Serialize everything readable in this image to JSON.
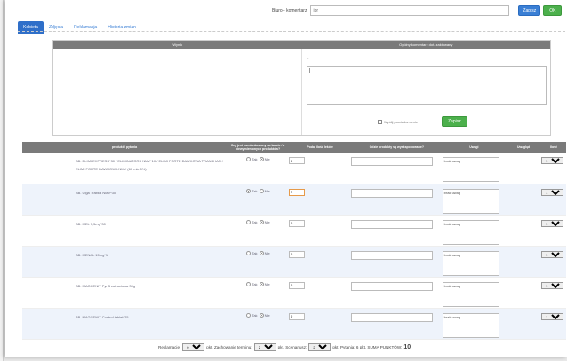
{
  "topbar": {
    "search_label": "Biuro - komentarz",
    "search_value": "ipr",
    "save_label": "Zapisz",
    "ok_label": "OK"
  },
  "tabs": [
    {
      "label": "Kobieta"
    },
    {
      "label": "Zdjęcia"
    },
    {
      "label": "Reklamacja"
    },
    {
      "label": "Historia zmian"
    }
  ],
  "comments": {
    "col_left": "Wynik",
    "col_right": "Ogólny komentarz dot. zaktowany",
    "dash": "-",
    "textarea": "|",
    "checkbox_label": "Wyślij powiadomienie",
    "save_label": "Zapisz"
  },
  "table": {
    "headers": [
      "produkt / pytania",
      "Czy jest wzmiankowany na karcie / z niewymienionych produktów?",
      "Podaj ilość leków",
      "Gdzie produkty są wyeksponowane?",
      "Uwagi",
      "Uwzględ",
      "Ilość"
    ],
    "rows": [
      {
        "name": "BB. ELIMI EXPRESS*30 / ELIMINATORS NMV*10 / ELIMI FORTE DAWKOWA TRANSHAN / ELIMI FORTE DAWKOWA NMV (60 mlc 5%)",
        "radio": "Nie",
        "qty": "0",
        "note": "brak uwag",
        "count": "1"
      },
      {
        "name": "BB. Ulga Trabka NMV*30",
        "radio": "Tak",
        "qty": "2",
        "note": "brak uwag",
        "count": "1"
      },
      {
        "name": "BB. MEL 7,5mg*30",
        "radio": "Nie",
        "qty": "0",
        "note": "brak uwag",
        "count": "1"
      },
      {
        "name": "BB. MENAL 15mg*1",
        "radio": "Nie",
        "qty": "0",
        "note": "brak uwag",
        "count": "1"
      },
      {
        "name": "BB. MAGCENIT Pyr 5 zatruciowa 30g",
        "radio": "Nie",
        "qty": "0",
        "note": "brak uwag",
        "count": "1"
      },
      {
        "name": "BB. MAGCENIT Control tablet*25",
        "radio": "Nie",
        "qty": "0",
        "note": "brak uwag",
        "count": "1"
      }
    ],
    "yes": "Tak",
    "no": "Nie"
  },
  "footer": {
    "reklamacje": "Reklamacje:",
    "reklamacje_val": "0",
    "pkt": "pkt.",
    "zachowanie": "Zachowanie terminu:",
    "zachowanie_val": "2",
    "scenariusz": "Scenariusz:",
    "scenariusz_val": "2",
    "pytania": "pkt. Pytania: 6",
    "suma_label": "pkt. SUMA PUNKTÓW:",
    "suma": "10"
  }
}
